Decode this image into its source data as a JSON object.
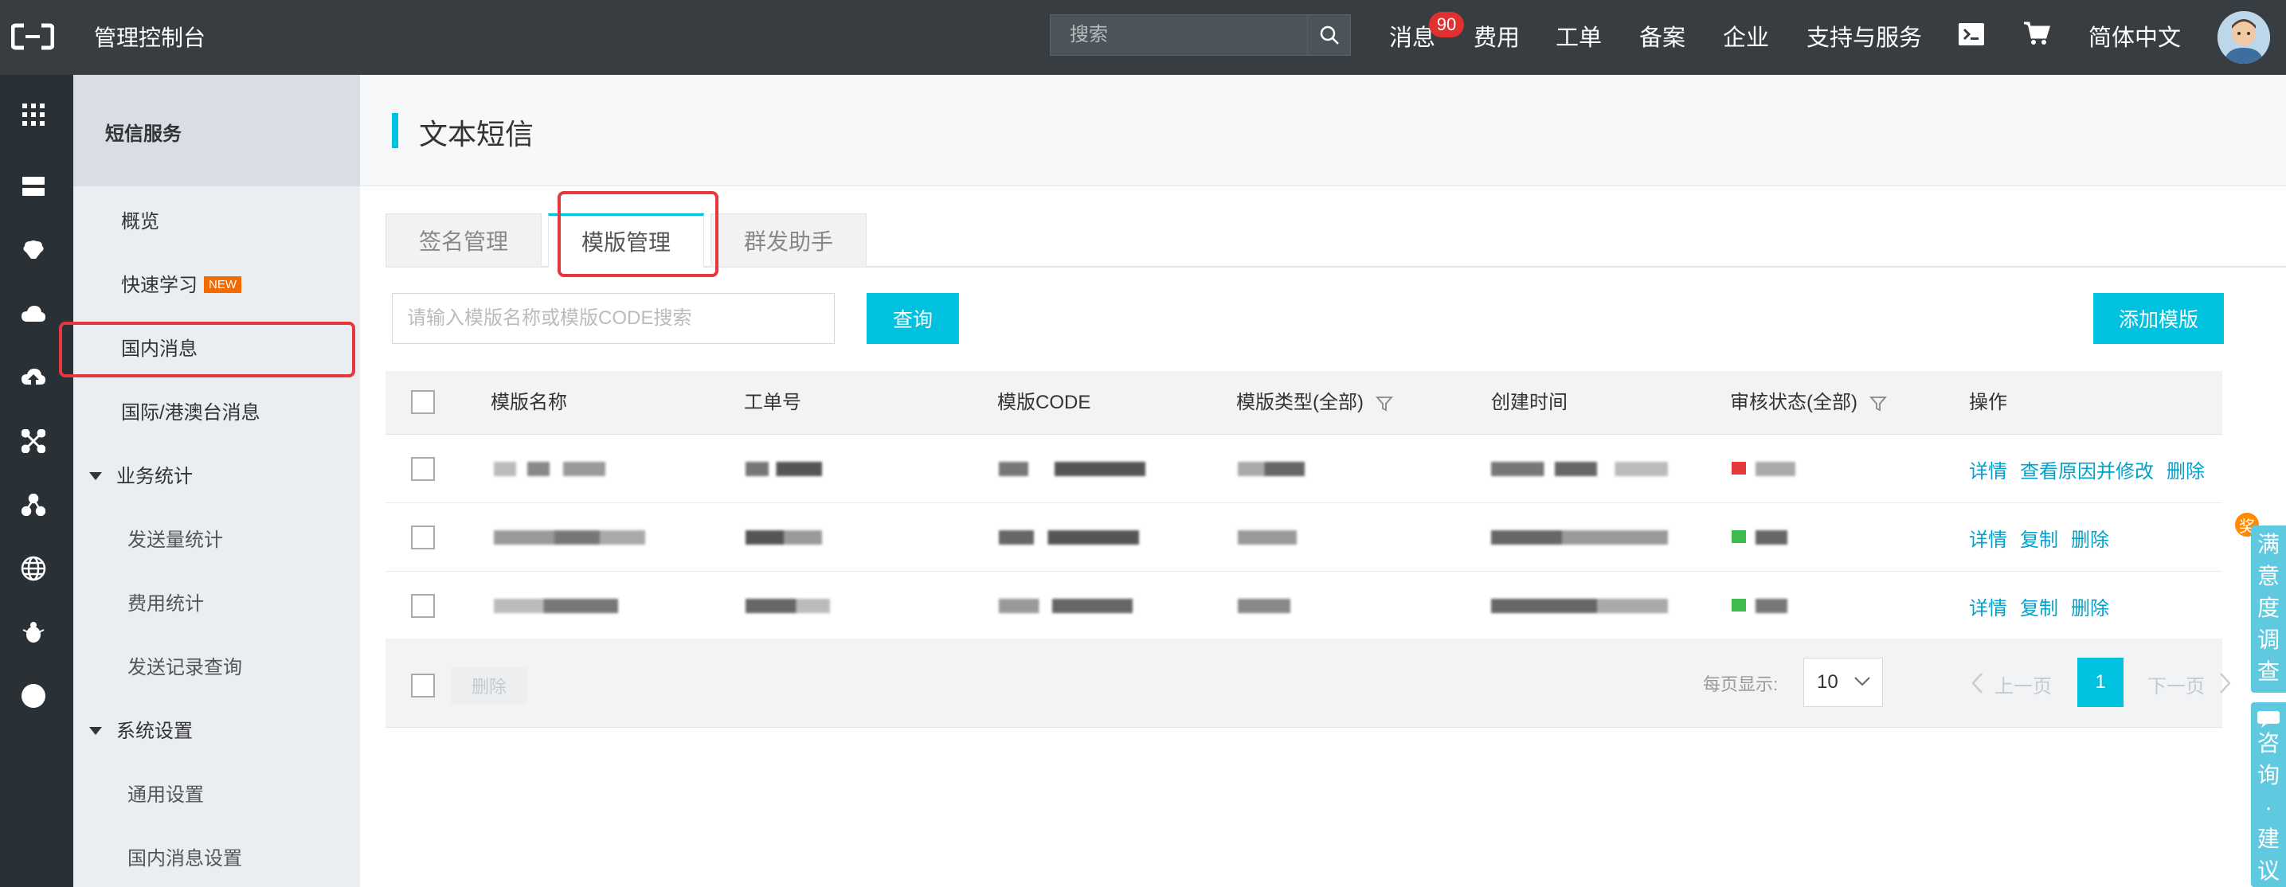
{
  "header": {
    "app_title": "管理控制台",
    "search_placeholder": "搜索",
    "nav": [
      {
        "label": "消息"
      },
      {
        "label": "费用"
      },
      {
        "label": "工单"
      },
      {
        "label": "备案"
      },
      {
        "label": "企业"
      },
      {
        "label": "支持与服务"
      },
      {
        "label": "简体中文"
      }
    ],
    "message_badge": "90",
    "icons": [
      "terminal-icon",
      "cart-icon"
    ]
  },
  "rail": {
    "icons": [
      "grid-icon",
      "server-icon",
      "brain-icon",
      "cloud-icon",
      "cloud-upload-icon",
      "network-icon",
      "cluster-icon",
      "globe-icon",
      "bug-icon",
      "circle-icon"
    ]
  },
  "sidebar": {
    "title": "短信服务",
    "items": [
      {
        "label": "概览"
      },
      {
        "label": "快速学习",
        "badge": "NEW"
      },
      {
        "label": "国内消息"
      },
      {
        "label": "国际/港澳台消息"
      }
    ],
    "groups": [
      {
        "label": "业务统计",
        "items": [
          "发送量统计",
          "费用统计",
          "发送记录查询"
        ]
      },
      {
        "label": "系统设置",
        "items": [
          "通用设置",
          "国内消息设置"
        ]
      }
    ]
  },
  "main": {
    "title": "文本短信",
    "tabs": [
      {
        "label": "签名管理"
      },
      {
        "label": "模版管理",
        "active": true
      },
      {
        "label": "群发助手"
      }
    ],
    "query_placeholder": "请输入模版名称或模版CODE搜索",
    "query_button": "查询",
    "add_button": "添加模版",
    "table": {
      "headers": [
        "模版名称",
        "工单号",
        "模版CODE",
        "模版类型(全部)",
        "创建时间",
        "审核状态(全部)",
        "操作"
      ],
      "rows": [
        {
          "status_color": "#e4393c",
          "actions": [
            "详情",
            "查看原因并修改",
            "删除"
          ]
        },
        {
          "status_color": "#3dbb4f",
          "actions": [
            "详情",
            "复制",
            "删除"
          ]
        },
        {
          "status_color": "#3dbb4f",
          "actions": [
            "详情",
            "复制",
            "删除"
          ]
        }
      ]
    },
    "footer": {
      "delete_label": "删除",
      "page_size_label": "每页显示:",
      "page_size": "10",
      "prev_label": "上一页",
      "next_label": "下一页",
      "current_page": "1"
    }
  },
  "floating": {
    "survey_badge": "奖",
    "survey_label": "满意度调查",
    "consult_label": "咨询·建议"
  },
  "colors": {
    "accent": "#00c1de",
    "topbar": "#373d41",
    "highlight": "#e4393c",
    "link": "#00a2ca"
  }
}
